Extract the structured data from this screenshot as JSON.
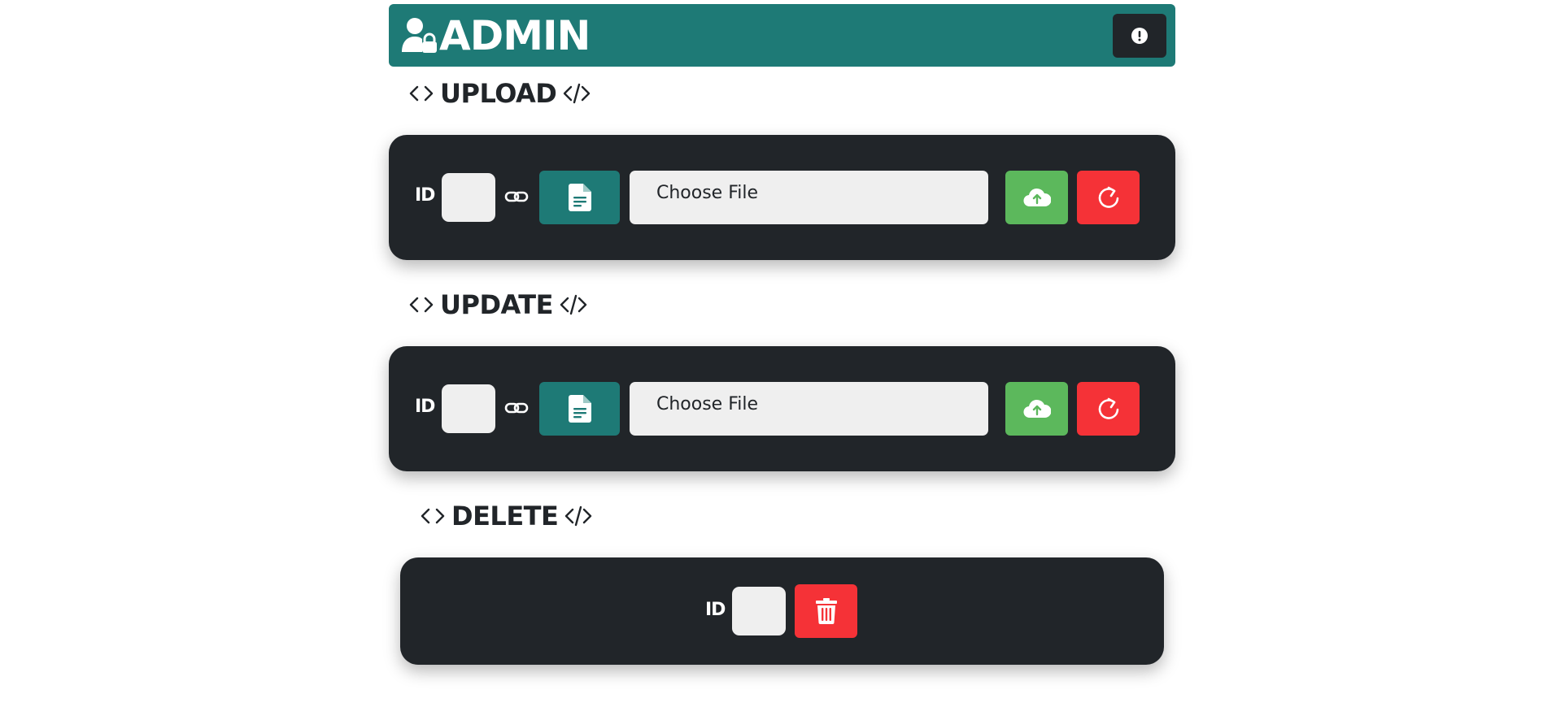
{
  "header": {
    "title": "ADMIN",
    "icon": "user-lock-icon",
    "info_icon": "exclamation-circle-icon",
    "background_color": "#1e7a76"
  },
  "sections": {
    "upload": {
      "title": "UPLOAD",
      "id_label": "ID",
      "id_value": "",
      "file_placeholder": "Choose File"
    },
    "update": {
      "title": "UPDATE",
      "id_label": "ID",
      "id_value": "",
      "file_placeholder": "Choose File"
    },
    "delete": {
      "title": "DELETE",
      "id_label": "ID",
      "id_value": ""
    }
  },
  "icons": {
    "title_left": "code-icon",
    "title_right": "code-slash-icon",
    "link": "link-icon",
    "document": "file-text-icon",
    "upload": "cloud-upload-icon",
    "reset": "rotate-icon",
    "delete": "trash-icon"
  },
  "colors": {
    "panel": "#212529",
    "teal": "#1e7a76",
    "green": "#5cb85c",
    "red": "#f53237",
    "input": "#efefef"
  }
}
